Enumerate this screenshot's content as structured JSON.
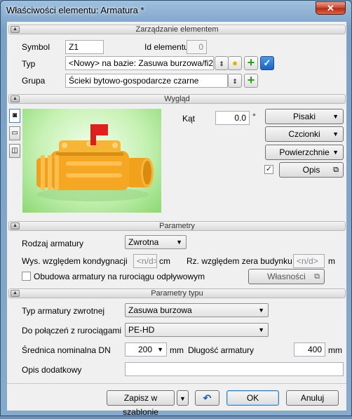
{
  "window": {
    "title": "Właściwości elementu: Armatura *",
    "close_glyph": "✕"
  },
  "sections": {
    "management": "Zarządzanie elementem",
    "appearance": "Wygląd",
    "parameters": "Parametry",
    "type_parameters": "Parametry typu"
  },
  "management": {
    "symbol_label": "Symbol",
    "symbol_value": "Z1",
    "id_label": "Id elementu",
    "id_value": "0",
    "type_label": "Typ",
    "type_value": "<Nowy> na bazie: Zasuwa burzowa/fi200",
    "group_label": "Grupa",
    "group_value": "Ścieki bytowo-gospodarcze czarne"
  },
  "appearance": {
    "angle_label": "Kąt",
    "angle_value": "0.0",
    "angle_unit": "°",
    "pens_label": "Pisaki",
    "fonts_label": "Czcionki",
    "surfaces_label": "Powierzchnie",
    "desc_label": "Opis",
    "desc_checked": true
  },
  "parameters": {
    "kind_label": "Rodzaj armatury",
    "kind_value": "Zwrotna",
    "height_label": "Wys. względem kondygnacji",
    "height_placeholder": "<n/d>",
    "height_unit": "cm",
    "elev_label": "Rz. względem zera budynku",
    "elev_placeholder": "<n/d>",
    "elev_unit": "m",
    "housing_label": "Obudowa armatury na rurociągu odpływowym",
    "housing_checked": false,
    "properties_label": "Własności"
  },
  "type_parameters": {
    "check_type_label": "Typ armatury zwrotnej",
    "check_type_value": "Zasuwa burzowa",
    "connect_label": "Do połączeń z rurociągami",
    "connect_value": "PE-HD",
    "dn_label": "Średnica nominalna DN",
    "dn_value": "200",
    "dn_unit": "mm",
    "length_label": "Długość armatury",
    "length_value": "400",
    "length_unit": "mm",
    "extra_desc_label": "Opis dodatkowy",
    "extra_desc_value": ""
  },
  "footer": {
    "save_template_label": "Zapisz w szablonie",
    "ok_label": "OK",
    "cancel_label": "Anuluj"
  },
  "colors": {
    "preview_bg": "#c6f1b3",
    "valve_orange": "#f5a623",
    "valve_red": "#e0201c",
    "accent_green": "#2c9d1b"
  }
}
